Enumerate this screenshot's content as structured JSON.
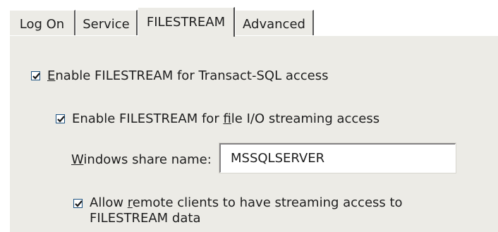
{
  "tabs": [
    {
      "label": "Log On",
      "active": false
    },
    {
      "label": "Service",
      "active": false
    },
    {
      "label": "FILESTREAM",
      "active": true
    },
    {
      "label": "Advanced",
      "active": false
    }
  ],
  "filestream": {
    "enable_tsql": {
      "mnemonic": "E",
      "label_rest": "nable FILESTREAM for Transact-SQL access",
      "checked": true
    },
    "enable_fileio": {
      "label_pre": "Enable FILESTREAM for ",
      "mnemonic": "f",
      "label_post": "ile I/O streaming access",
      "checked": true
    },
    "share_name": {
      "mnemonic": "W",
      "label_rest": "indows share name:",
      "value": "MSSQLSERVER"
    },
    "allow_remote": {
      "label_pre": "Allow ",
      "mnemonic": "r",
      "label_post": "emote clients to have streaming access to FILESTREAM data",
      "checked": true
    }
  },
  "colors": {
    "dialog_bg": "#ecebe6",
    "checkbox_border": "#1c5180",
    "check_mark": "#21a121"
  },
  "icons": {
    "check": "check-mark-icon"
  }
}
